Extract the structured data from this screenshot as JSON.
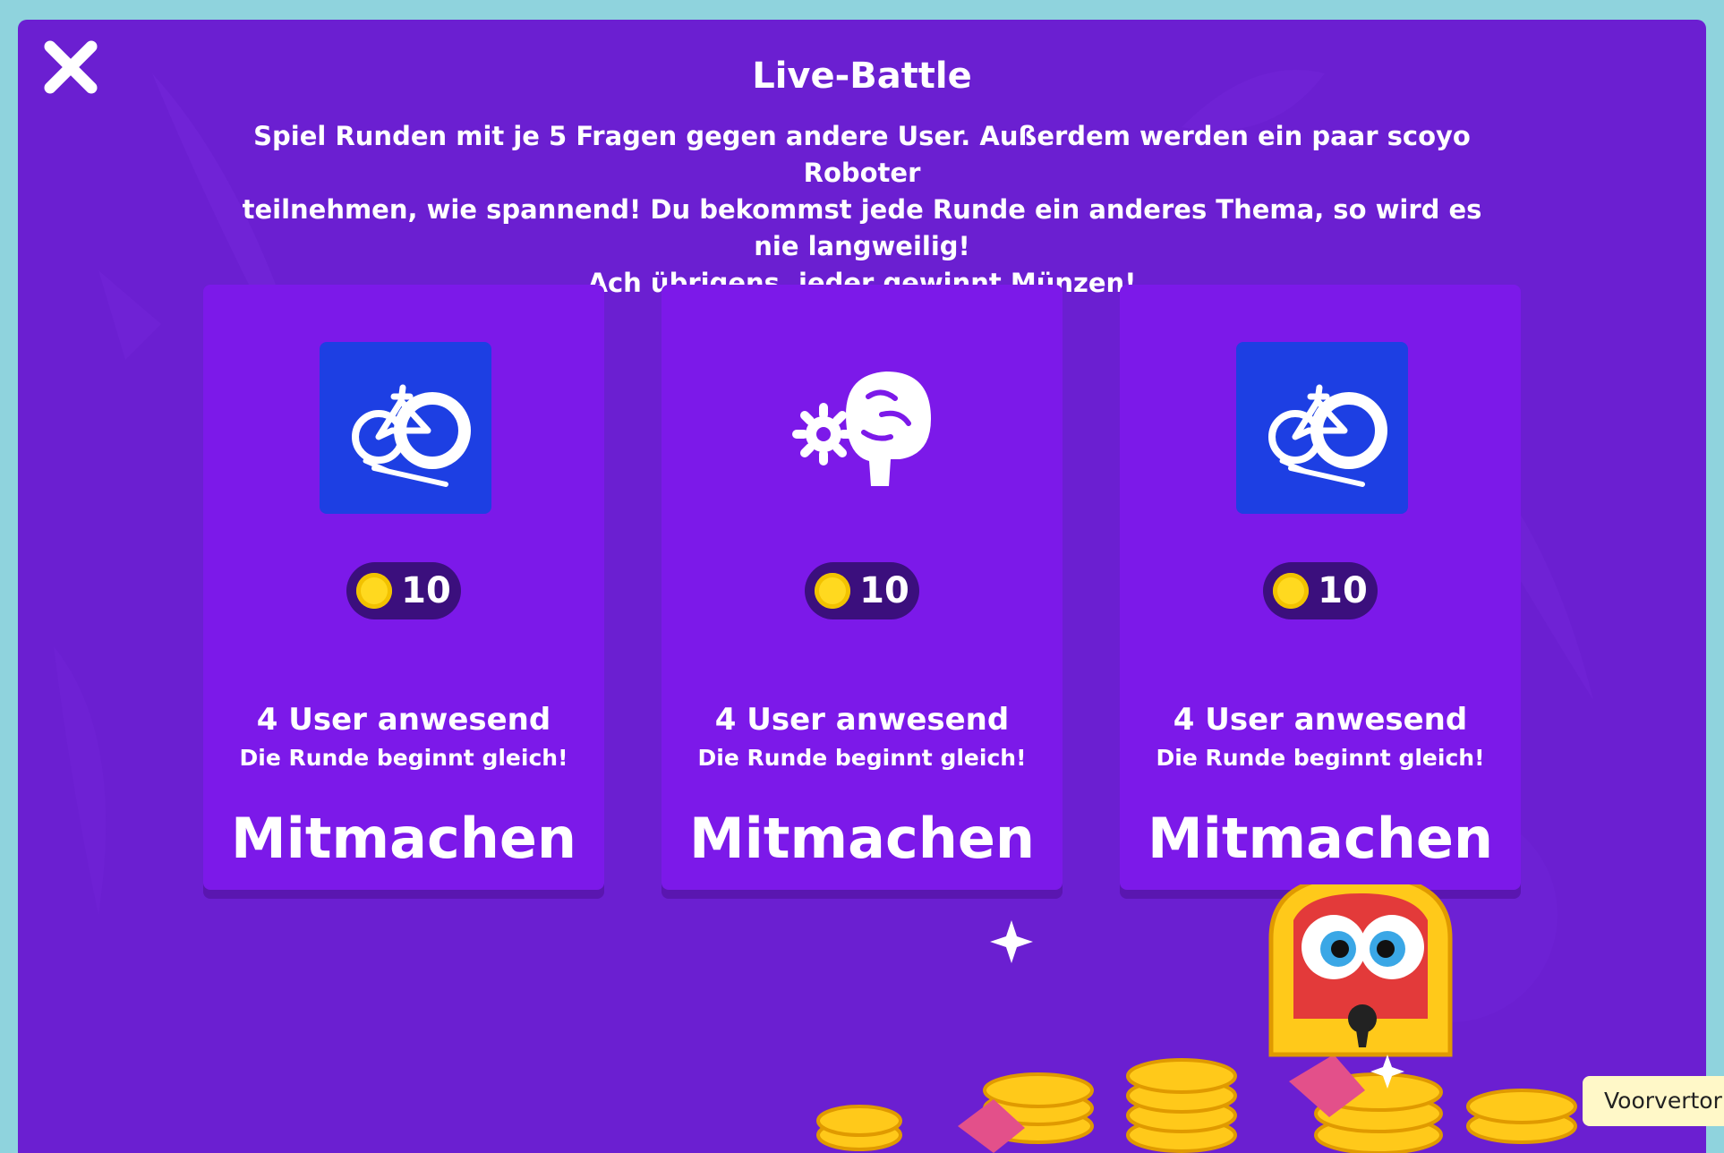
{
  "dialog": {
    "title": "Live-Battle",
    "description_lines": [
      "Spiel Runden mit je 5 Fragen gegen andere User. Außerdem werden ein paar scoyo Roboter",
      "teilnehmen, wie spannend! Du bekommst jede Runde ein anderes Thema, so wird es nie langweilig!",
      "Ach übrigens, jeder gewinnt Münzen!"
    ]
  },
  "close": {
    "icon": "close-icon"
  },
  "cards": [
    {
      "topic_icon": "bicycle-icon",
      "coins": "10",
      "users": "4 User anwesend",
      "status": "Die Runde beginnt gleich!",
      "action": "Mitmachen"
    },
    {
      "topic_icon": "brain-gear-icon",
      "coins": "10",
      "users": "4 User anwesend",
      "status": "Die Runde beginnt gleich!",
      "action": "Mitmachen"
    },
    {
      "topic_icon": "bicycle-icon",
      "coins": "10",
      "users": "4 User anwesend",
      "status": "Die Runde beginnt gleich!",
      "action": "Mitmachen"
    }
  ],
  "tooltip": {
    "text": "Voorvertor"
  },
  "colors": {
    "background": "#6b1fd1",
    "card": "#7c19e9",
    "topic_blue": "#1d3fe3",
    "coin": "#ffd91f",
    "pill": "#3b0f7d"
  }
}
